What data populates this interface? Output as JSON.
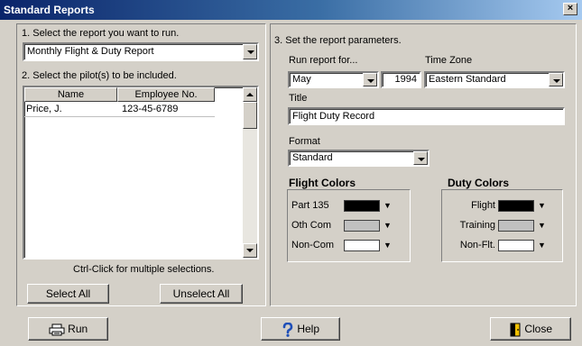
{
  "window": {
    "title": "Standard Reports",
    "close_glyph": "×"
  },
  "left": {
    "step1_label": "1. Select the report you want to run.",
    "report_select": {
      "value": "Monthly Flight & Duty Report"
    },
    "step2_label": "2. Select the pilot(s) to be included.",
    "pilot_table": {
      "columns": [
        "Name",
        "Employee No."
      ],
      "rows": [
        {
          "name": "Price, J.",
          "employee_no": "123-45-6789"
        }
      ]
    },
    "hint": "Ctrl-Click for multiple selections.",
    "select_all_label": "Select All",
    "unselect_all_label": "Unselect All"
  },
  "right": {
    "step3_label": "3. Set the report parameters.",
    "run_report_for_label": "Run report for...",
    "month_value": "May",
    "year_value": "1994",
    "time_zone_label": "Time Zone",
    "time_zone_value": "Eastern Standard",
    "title_label": "Title",
    "title_value": "Flight Duty Record",
    "format_label": "Format",
    "format_value": "Standard",
    "flight_colors": {
      "heading": "Flight Colors",
      "items": [
        {
          "label": "Part 135",
          "color": "#000000"
        },
        {
          "label": "Oth Com",
          "color": "#c0c0c0"
        },
        {
          "label": "Non-Com",
          "color": "#ffffff"
        }
      ]
    },
    "duty_colors": {
      "heading": "Duty Colors",
      "items": [
        {
          "label": "Flight",
          "color": "#000000"
        },
        {
          "label": "Training",
          "color": "#c0c0c0"
        },
        {
          "label": "Non-Flt.",
          "color": "#ffffff"
        }
      ]
    }
  },
  "footer": {
    "run_label": "Run",
    "run_icon": "printer-icon",
    "help_label": "Help",
    "help_icon": "question-mark-icon",
    "close_label": "Close",
    "close_icon": "door-exit-icon"
  }
}
